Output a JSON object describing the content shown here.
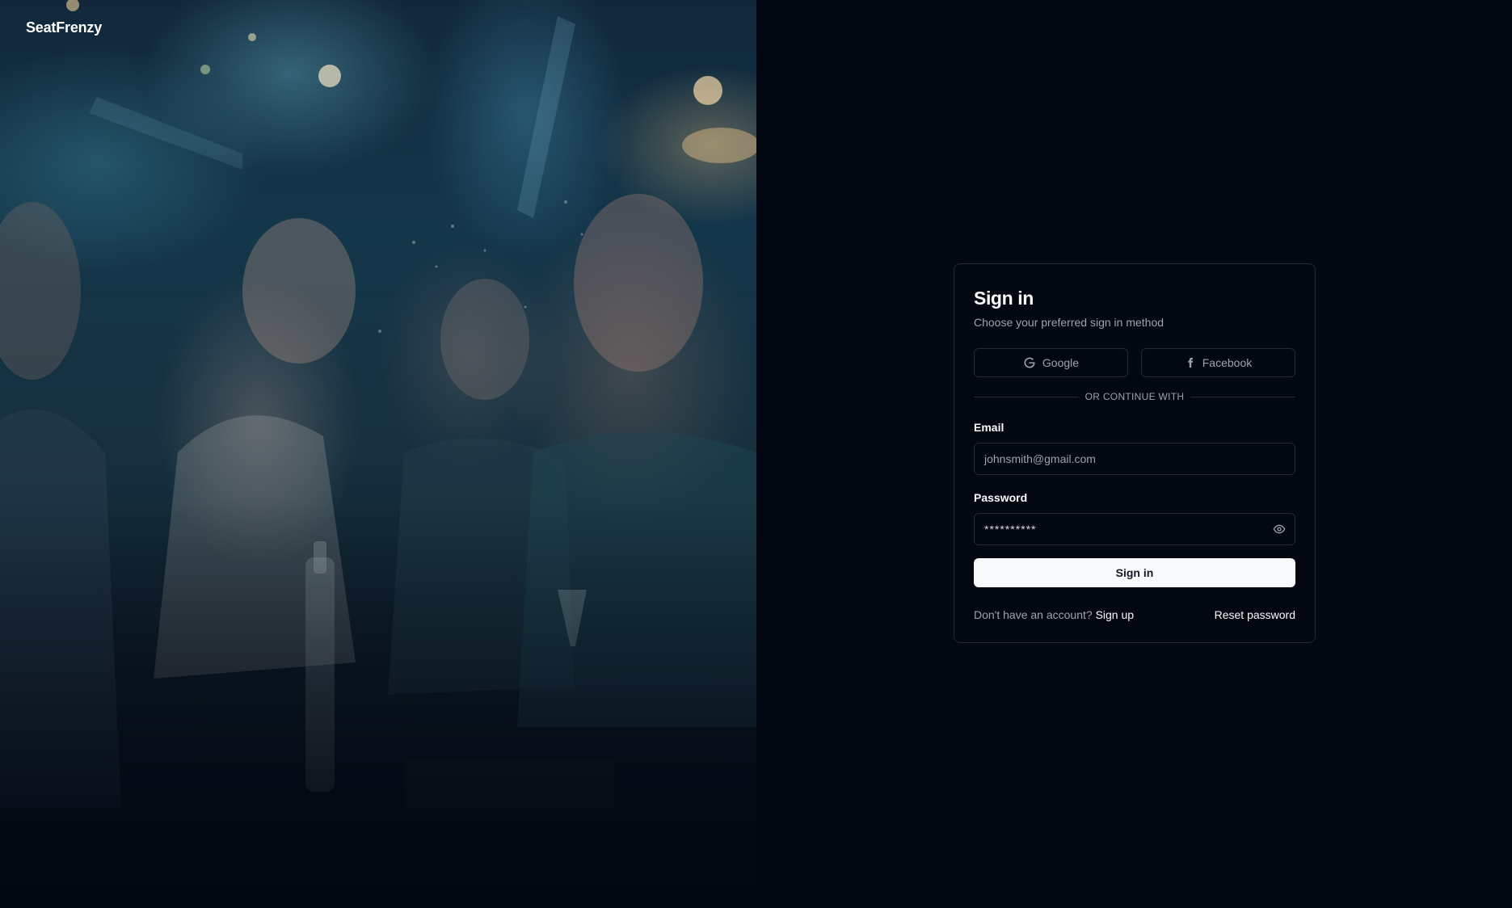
{
  "brand": {
    "name": "SeatFrenzy"
  },
  "signin": {
    "title": "Sign in",
    "subtitle": "Choose your preferred sign in method",
    "oauth": {
      "google_label": "Google",
      "facebook_label": "Facebook"
    },
    "divider_text": "OR CONTINUE WITH",
    "email": {
      "label": "Email",
      "value": "johnsmith@gmail.com"
    },
    "password": {
      "label": "Password",
      "value": "**********"
    },
    "submit_label": "Sign in",
    "footer": {
      "no_account_text": "Don't have an account?",
      "signup_link": "Sign up",
      "reset_link": "Reset password"
    }
  },
  "icons": {
    "google": "google-icon",
    "facebook": "facebook-icon",
    "show_password": "eye-icon"
  },
  "colors": {
    "background": "#030712",
    "card_border": "#1f2937",
    "text_primary": "#f9fafb",
    "text_muted": "#9ca3af",
    "button_bg": "#f9fafb"
  }
}
